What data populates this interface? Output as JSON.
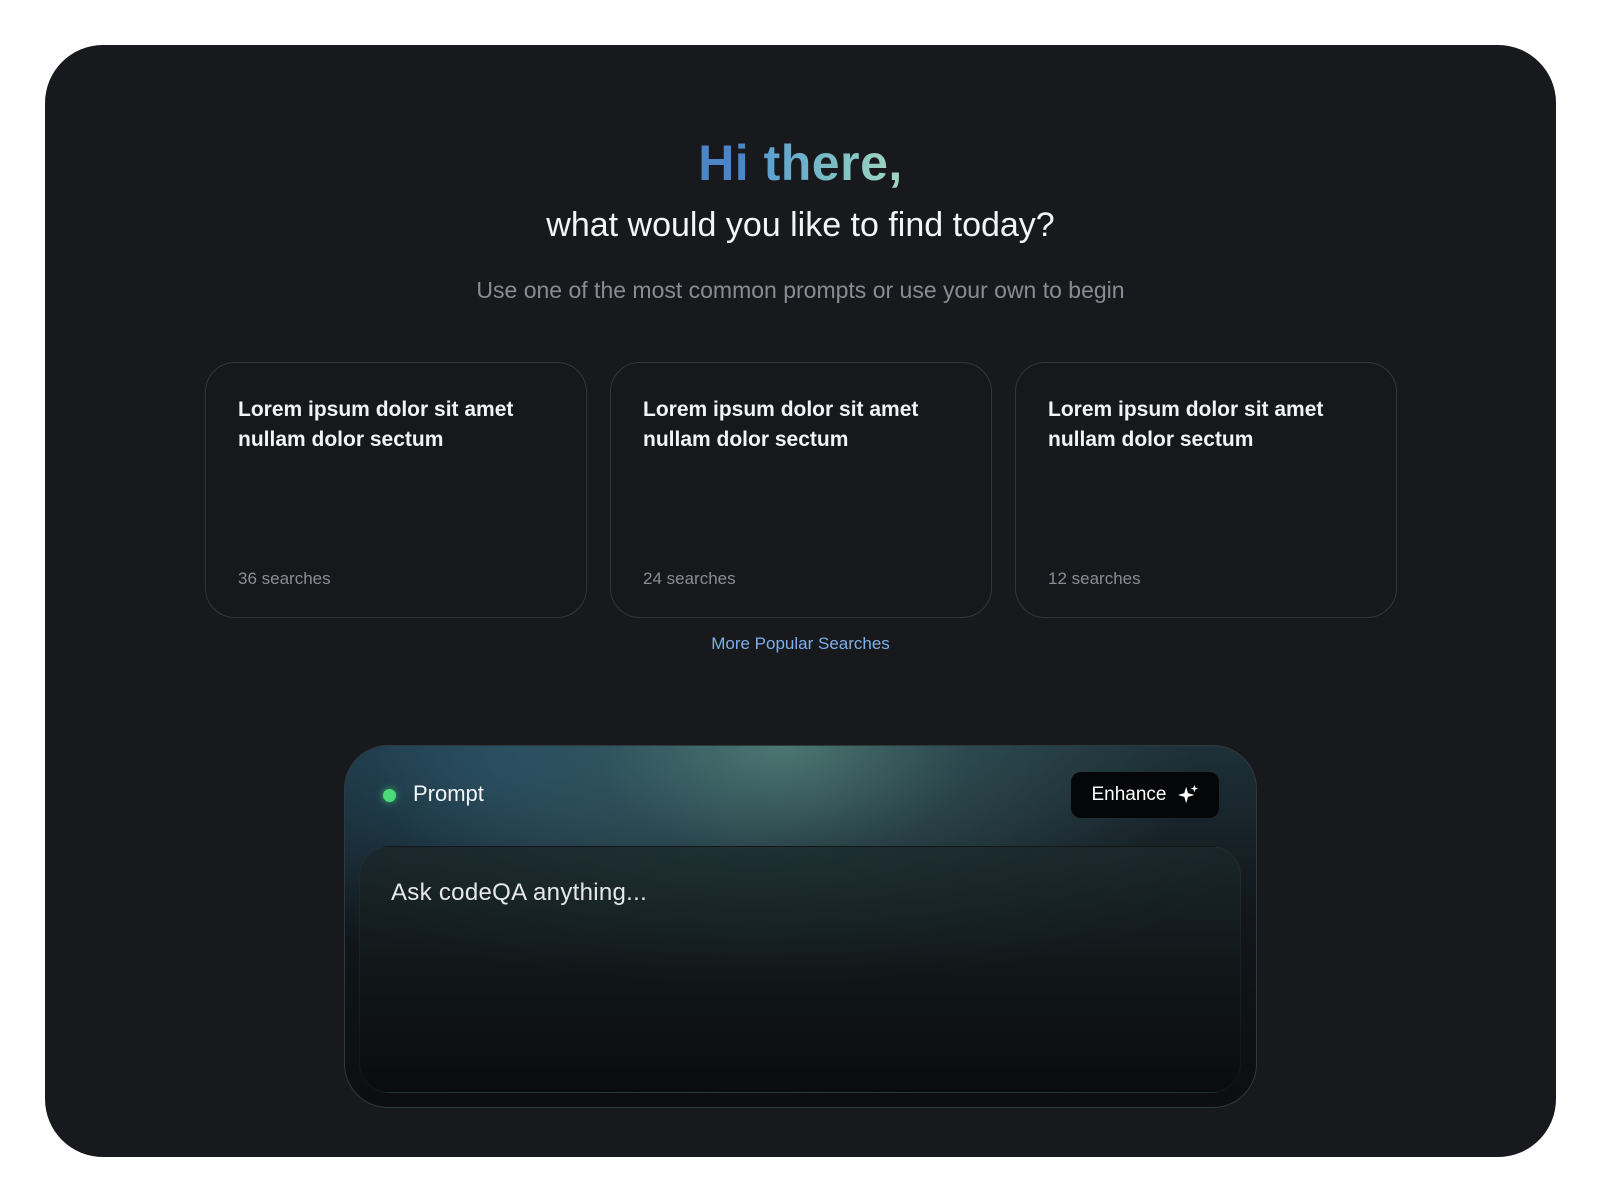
{
  "header": {
    "greeting_hi": "Hi",
    "greeting_there": "there,",
    "subtitle": "what would you like to find today?",
    "hint": "Use one of the most common prompts or use your own to begin"
  },
  "cards": [
    {
      "title": "Lorem ipsum dolor sit amet nullam dolor sectum",
      "meta": "36 searches"
    },
    {
      "title": "Lorem ipsum dolor sit amet nullam dolor sectum",
      "meta": "24 searches"
    },
    {
      "title": "Lorem ipsum dolor sit amet nullam dolor sectum",
      "meta": "12 searches"
    }
  ],
  "more_link": "More Popular Searches",
  "prompt": {
    "label": "Prompt",
    "status_color": "#4ddb7a",
    "enhance_label": "Enhance",
    "enhance_icon": "sparkle-icon",
    "placeholder": "Ask codeQA anything..."
  },
  "colors": {
    "background": "#18191d",
    "accent_link": "#7eb0ea",
    "greeting_blue": "#4a86c8",
    "greeting_teal": "#7fc1c4"
  }
}
